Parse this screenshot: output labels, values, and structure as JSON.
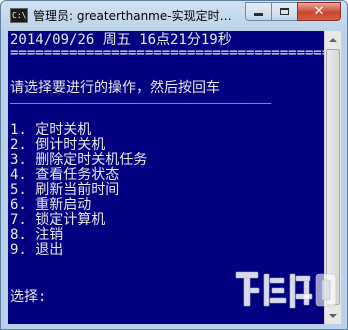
{
  "window": {
    "title": "管理员: greaterthanme-实现定时…"
  },
  "console": {
    "datetime": "2014/09/26 周五 16点21分19秒",
    "separator": "=======================================",
    "prompt": "请选择要进行的操作，然后按回车",
    "underline": "_______________________________",
    "menu": [
      "1. 定时关机",
      "2. 倒计时关机",
      "3. 删除定时关机任务",
      "4. 查看任务状态",
      "5. 刷新当前时间",
      "6. 重新启动",
      "7. 锁定计算机",
      "8. 注销",
      "9. 退出"
    ],
    "input_prompt": "选择:"
  },
  "colors": {
    "console_background": "#000080",
    "console_text": "#e8e8e8",
    "close_button": "#c8462f"
  },
  "icons": {
    "app": "console-icon",
    "minimize": "minimize-icon",
    "maximize": "maximize-icon",
    "close": "close-icon",
    "watermark": "download-site-watermark"
  }
}
